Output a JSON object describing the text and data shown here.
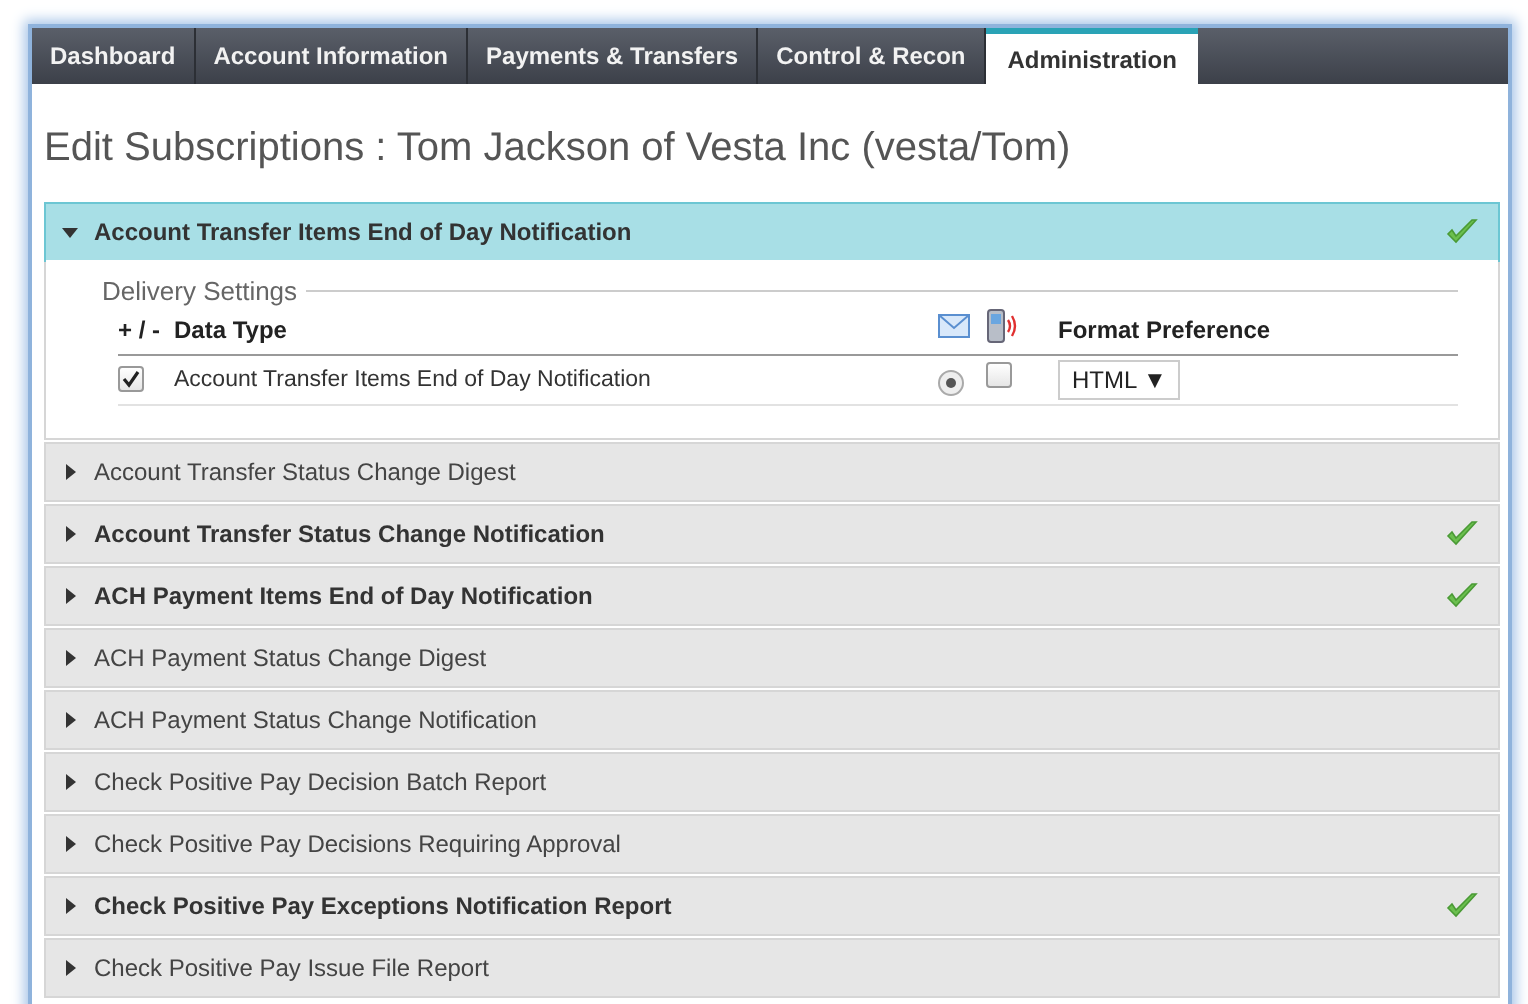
{
  "tabs": [
    {
      "label": "Dashboard",
      "selected": false
    },
    {
      "label": "Account Information",
      "selected": false
    },
    {
      "label": "Payments & Transfers",
      "selected": false
    },
    {
      "label": "Control & Recon",
      "selected": false
    },
    {
      "label": "Administration",
      "selected": true
    }
  ],
  "page_title": "Edit Subscriptions : Tom Jackson of Vesta Inc (vesta/Tom)",
  "sections": [
    {
      "label": "Account Transfer Items End of Day Notification",
      "expanded": true,
      "subscribed": true,
      "delivery": {
        "legend": "Delivery Settings",
        "columns": {
          "toggle": "+ / -",
          "data_type": "Data Type",
          "format": "Format Preference"
        },
        "rows": [
          {
            "checked": true,
            "label": "Account Transfer Items End of Day Notification",
            "email_selected": true,
            "sms_checked": false,
            "format": "HTML ▼"
          }
        ]
      }
    },
    {
      "label": "Account Transfer Status Change Digest",
      "expanded": false,
      "subscribed": false
    },
    {
      "label": "Account Transfer Status Change Notification",
      "expanded": false,
      "subscribed": true
    },
    {
      "label": "ACH Payment Items End of Day Notification",
      "expanded": false,
      "subscribed": true
    },
    {
      "label": "ACH Payment Status Change Digest",
      "expanded": false,
      "subscribed": false
    },
    {
      "label": "ACH Payment Status Change Notification",
      "expanded": false,
      "subscribed": false
    },
    {
      "label": "Check Positive Pay Decision Batch Report",
      "expanded": false,
      "subscribed": false
    },
    {
      "label": "Check Positive Pay Decisions Requiring Approval",
      "expanded": false,
      "subscribed": false
    },
    {
      "label": "Check Positive Pay Exceptions Notification Report",
      "expanded": false,
      "subscribed": true
    },
    {
      "label": "Check Positive Pay Issue File Report",
      "expanded": false,
      "subscribed": false
    }
  ]
}
